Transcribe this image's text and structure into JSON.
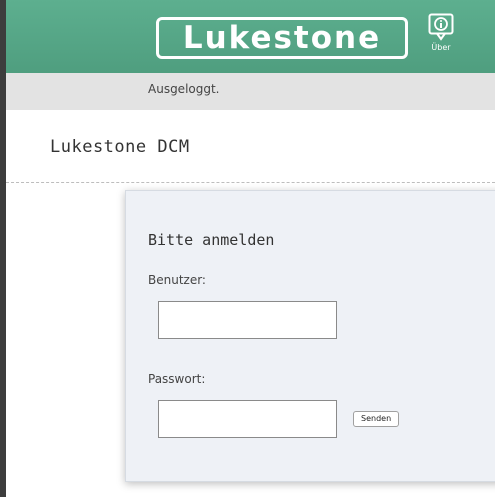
{
  "header": {
    "logo_text": "Lukestone",
    "about_label": "Über"
  },
  "status": {
    "text": "Ausgeloggt."
  },
  "page": {
    "title": "Lukestone DCM"
  },
  "login": {
    "title": "Bitte anmelden",
    "user_label": "Benutzer:",
    "user_value": "",
    "password_label": "Passwort:",
    "password_value": "",
    "submit_label": "Senden"
  },
  "colors": {
    "header": "#55a688",
    "statusbar": "#e3e3e3",
    "panel": "#eef1f6"
  },
  "icons": {
    "about": "info-icon"
  }
}
